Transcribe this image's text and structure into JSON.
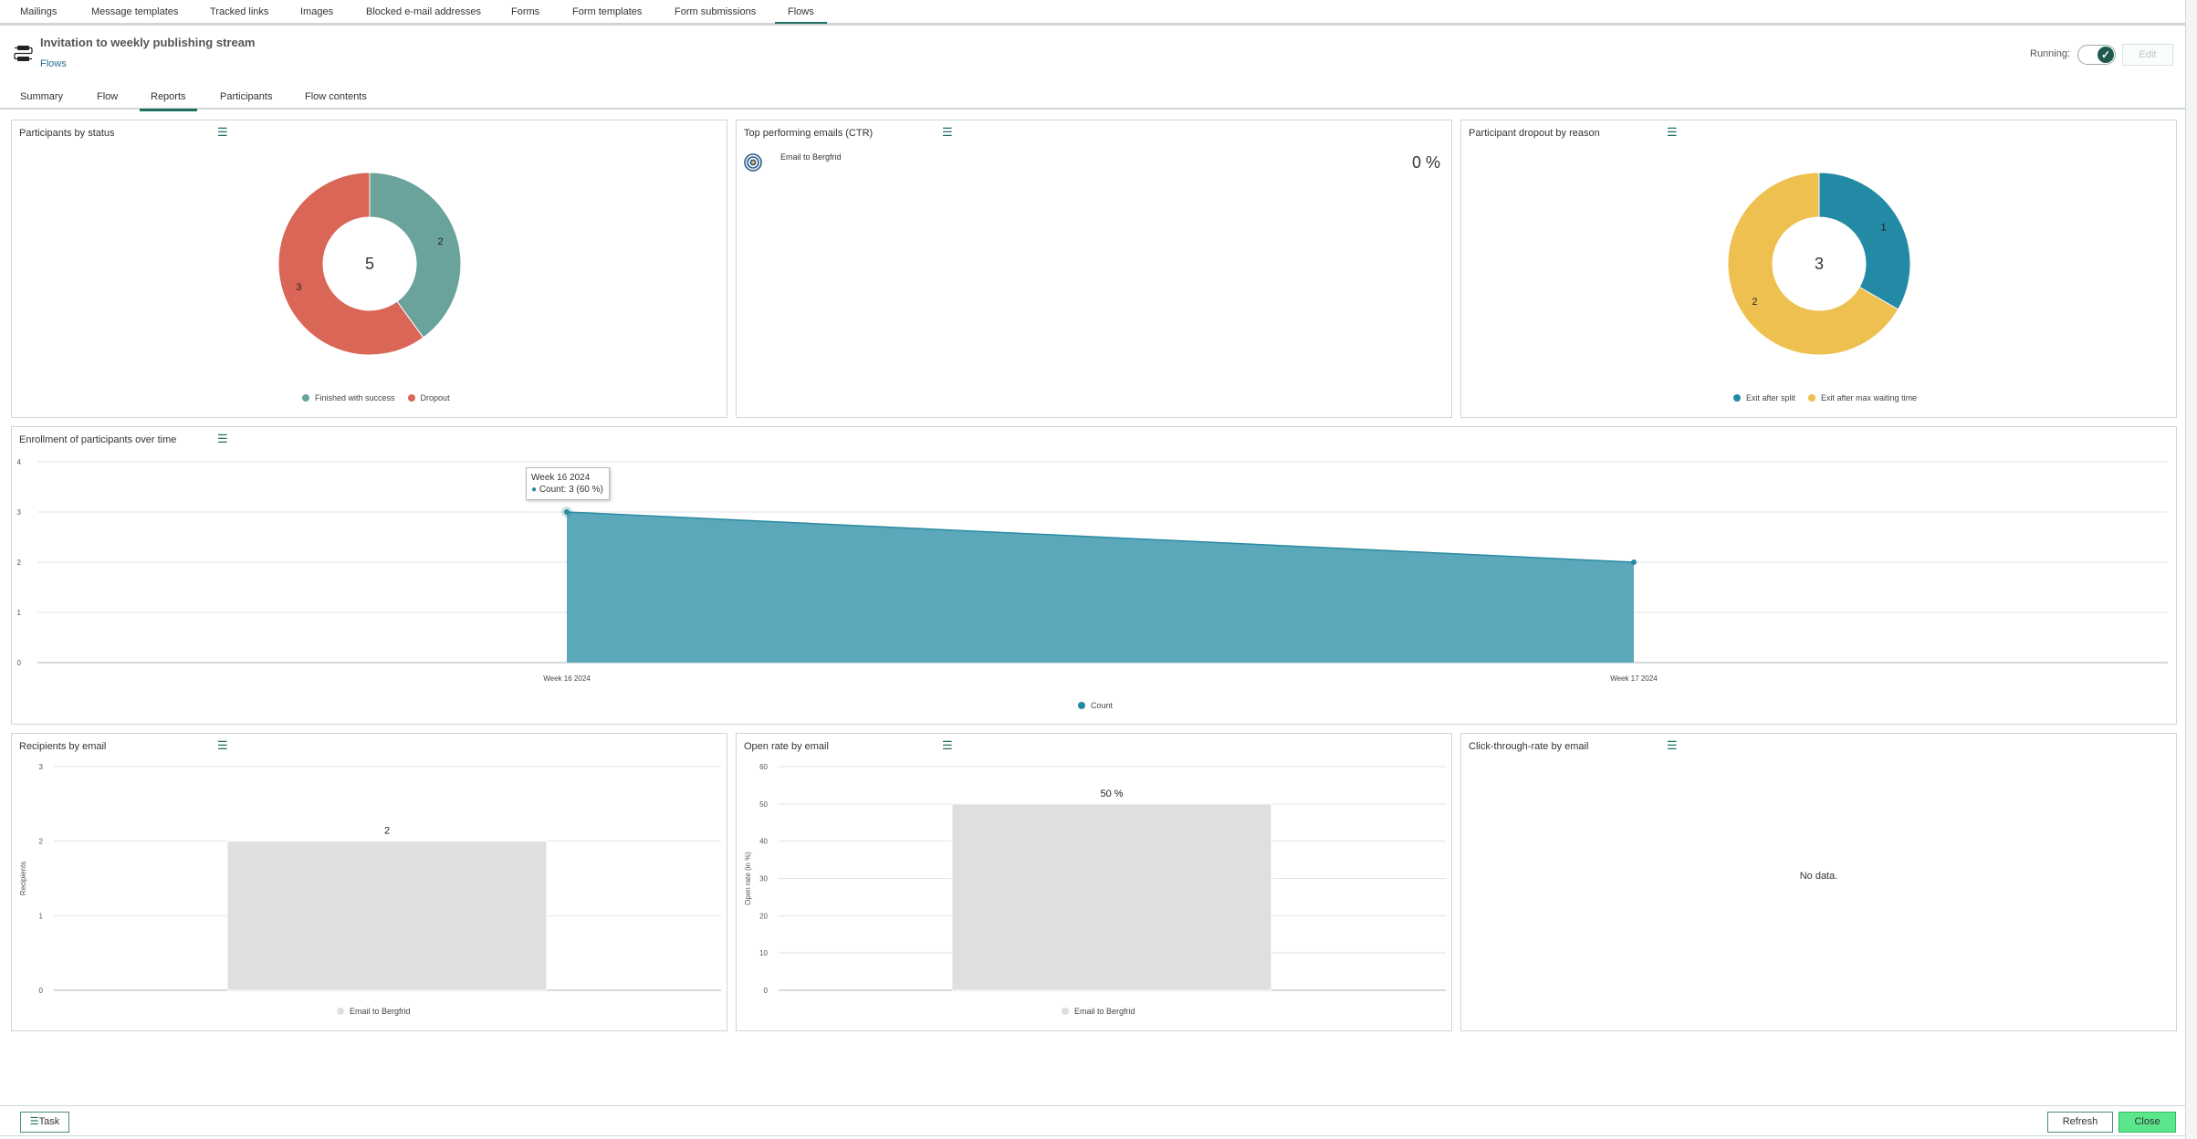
{
  "top_nav": {
    "items": [
      {
        "label": "Mailings",
        "active": false
      },
      {
        "label": "Message templates",
        "active": false
      },
      {
        "label": "Tracked links",
        "active": false
      },
      {
        "label": "Images",
        "active": false
      },
      {
        "label": "Blocked e-mail addresses",
        "active": false
      },
      {
        "label": "Forms",
        "active": false
      },
      {
        "label": "Form templates",
        "active": false
      },
      {
        "label": "Form submissions",
        "active": false
      },
      {
        "label": "Flows",
        "active": true
      }
    ]
  },
  "header": {
    "title": "Invitation to weekly publishing stream",
    "breadcrumb": "Flows",
    "running_label": "Running:",
    "running": true,
    "edit_label": "Edit"
  },
  "sub_tabs": {
    "items": [
      {
        "label": "Summary",
        "active": false
      },
      {
        "label": "Flow",
        "active": false
      },
      {
        "label": "Reports",
        "active": true
      },
      {
        "label": "Participants",
        "active": false
      },
      {
        "label": "Flow contents",
        "active": false
      }
    ]
  },
  "panels": {
    "status": {
      "title": "Participants by status",
      "menu_icon": "hamburger-menu-icon"
    },
    "top_emails": {
      "title": "Top performing emails (CTR)",
      "menu_icon": "hamburger-menu-icon",
      "items": [
        {
          "name": "Email to Bergfrid",
          "value": "0 %",
          "icon": "target-icon"
        }
      ]
    },
    "dropout": {
      "title": "Participant dropout by reason",
      "menu_icon": "hamburger-menu-icon"
    },
    "enrollment": {
      "title": "Enrollment of participants over time",
      "menu_icon": "hamburger-menu-icon",
      "tooltip": {
        "header": "Week 16 2024",
        "line": "Count: 3 (60 %)"
      }
    },
    "recipients": {
      "title": "Recipients by email",
      "menu_icon": "hamburger-menu-icon"
    },
    "open_rate": {
      "title": "Open rate by email",
      "menu_icon": "hamburger-menu-icon"
    },
    "ctr": {
      "title": "Click-through-rate by email",
      "menu_icon": "hamburger-menu-icon",
      "no_data": "No data."
    }
  },
  "footer": {
    "task_label": "Task",
    "refresh_label": "Refresh",
    "close_label": "Close"
  },
  "colors": {
    "accent": "#1f6f63",
    "success": "#6aa39c",
    "dropout": "#d96656",
    "exit_split": "#228aa4",
    "exit_wait": "#eec04f",
    "area": "#5ba8bb",
    "bar": "#dfdfdf",
    "close_button": "#5ae68a"
  },
  "chart_data": [
    {
      "id": "status",
      "type": "pie",
      "title": "Participants by status",
      "center_label": "5",
      "categories": [
        "Finished with success",
        "Dropout"
      ],
      "values": [
        2,
        3
      ],
      "colors": [
        "#6aa39c",
        "#d96656"
      ],
      "legend": "bottom"
    },
    {
      "id": "dropout",
      "type": "pie",
      "title": "Participant dropout by reason",
      "center_label": "3",
      "categories": [
        "Exit after split",
        "Exit after max waiting time"
      ],
      "values": [
        1,
        2
      ],
      "colors": [
        "#228aa4",
        "#eec04f"
      ],
      "legend": "bottom"
    },
    {
      "id": "enrollment",
      "type": "area",
      "title": "Enrollment of participants over time",
      "categories": [
        "Week 16 2024",
        "Week 17 2024"
      ],
      "series": [
        {
          "name": "Count",
          "values": [
            3,
            2
          ],
          "color": "#5ba8bb"
        }
      ],
      "ylim": [
        0,
        4
      ],
      "yticks": [
        0,
        1,
        2,
        3,
        4
      ],
      "grid": true,
      "legend": "bottom"
    },
    {
      "id": "recipients",
      "type": "bar",
      "title": "Recipients by email",
      "categories": [
        "Email to Bergfrid"
      ],
      "values": [
        2
      ],
      "data_labels": [
        "2"
      ],
      "ylabel": "Recipients",
      "ylim": [
        0,
        3
      ],
      "yticks": [
        0,
        1,
        2,
        3
      ],
      "grid": true,
      "legend": "bottom"
    },
    {
      "id": "open_rate",
      "type": "bar",
      "title": "Open rate by email",
      "categories": [
        "Email to Bergfrid"
      ],
      "values": [
        50
      ],
      "data_labels": [
        "50 %"
      ],
      "ylabel": "Open rate (in %)",
      "ylim": [
        0,
        60
      ],
      "yticks": [
        0,
        10,
        20,
        30,
        40,
        50,
        60
      ],
      "grid": true,
      "legend": "bottom"
    },
    {
      "id": "ctr",
      "type": "bar",
      "title": "Click-through-rate by email",
      "categories": [],
      "values": []
    }
  ]
}
